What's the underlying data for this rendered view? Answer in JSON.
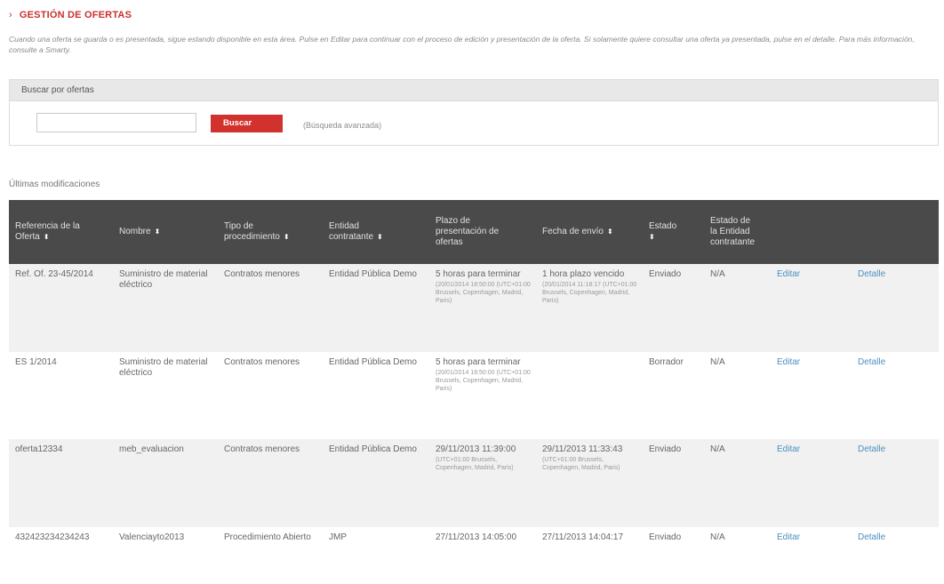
{
  "header": {
    "title": "GESTIÓN DE OFERTAS",
    "intro": "Cuando una oferta se guarda o es presentada, sigue estando disponible en esta área. Pulse en Editar para continuar con el proceso de edición y presentación de la oferta. Si solamente quiere consultar una oferta ya presentada, pulse en el detalle. Para más información, consulte a Smarty."
  },
  "search": {
    "title": "Buscar por ofertas",
    "input_value": "",
    "button_label": "Buscar",
    "advanced_label": "(Búsqueda avanzada)"
  },
  "recent": {
    "title": "Últimas modificaciones",
    "columns": [
      {
        "l1": "Referencia de la",
        "l2": "Oferta",
        "l3": "",
        "l4": ""
      },
      {
        "l1": "Nombre",
        "l2": "",
        "l3": "",
        "l4": ""
      },
      {
        "l1": "Tipo de",
        "l2": "procedimiento",
        "l3": "",
        "l4": ""
      },
      {
        "l1": "Entidad",
        "l2": "contratante",
        "l3": "",
        "l4": ""
      },
      {
        "l1": "Plazo de",
        "l2": "presentación de",
        "l3": "ofertas",
        "l4": ""
      },
      {
        "l1": "Fecha de envío",
        "l2": "",
        "l3": "",
        "l4": ""
      },
      {
        "l1": "Estado",
        "l2": "",
        "l3": "",
        "l4": ""
      },
      {
        "l1": "Estado de",
        "l2": "la Entidad",
        "l3": "contratante",
        "l4": ""
      },
      {
        "l1": "",
        "l2": "",
        "l3": "",
        "l4": ""
      },
      {
        "l1": "",
        "l2": "",
        "l3": "",
        "l4": ""
      }
    ],
    "sort_icon": "sort-updown-icon",
    "rows": [
      {
        "ref": "Ref. Of. 23-45/2014",
        "name": "Suministro de material eléctrico",
        "procedure": "Contratos menores",
        "entity": "Entidad Pública Demo",
        "deadline_main": "5 horas para terminar",
        "deadline_sub": "(20/01/2014 18:50:00 (UTC+01:00 Brussels, Copenhagen, Madrid, Paris)",
        "sent_main": "1 hora plazo vencido",
        "sent_sub": "(20/01/2014 11:18:17 (UTC+01:00 Brussels, Copenhagen, Madrid, Paris)",
        "status": "Enviado",
        "entity_status": "N/A",
        "edit_label": "Editar",
        "detail_label": "Detalle"
      },
      {
        "ref": "ES 1/2014",
        "name": "Suministro de material eléctrico",
        "procedure": "Contratos menores",
        "entity": "Entidad Pública Demo",
        "deadline_main": "5 horas para terminar",
        "deadline_sub": "(20/01/2014 18:50:00 (UTC+01:00 Brussels, Copenhagen, Madrid, Paris)",
        "sent_main": "",
        "sent_sub": "",
        "status": "Borrador",
        "entity_status": "N/A",
        "edit_label": "Editar",
        "detail_label": "Detalle"
      },
      {
        "ref": "oferta12334",
        "name": "meb_evaluacion",
        "procedure": "Contratos menores",
        "entity": "Entidad Pública Demo",
        "deadline_main": "29/11/2013 11:39:00",
        "deadline_sub": "(UTC+01:00 Brussels, Copenhagen, Madrid, Paris)",
        "sent_main": "29/11/2013 11:33:43",
        "sent_sub": "(UTC+01:00 Brussels, Copenhagen, Madrid, Paris)",
        "status": "Enviado",
        "entity_status": "N/A",
        "edit_label": "Editar",
        "detail_label": "Detalle"
      },
      {
        "ref": "432423234234243",
        "name": "Valenciayto2013",
        "procedure": "Procedimiento Abierto",
        "entity": "JMP",
        "deadline_main": "27/11/2013 14:05:00",
        "deadline_sub": "",
        "sent_main": "27/11/2013 14:04:17",
        "sent_sub": "",
        "status": "Enviado",
        "entity_status": "N/A",
        "edit_label": "Editar",
        "detail_label": "Detalle"
      }
    ]
  },
  "colors": {
    "brand_red": "#c8312b",
    "button_red": "#d2322d",
    "table_header": "#4a4a4a",
    "link_blue": "#4a90c2"
  }
}
